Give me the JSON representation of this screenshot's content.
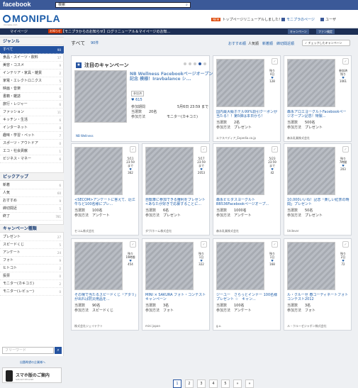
{
  "facebook": {
    "logo": "facebook",
    "search": "検索"
  },
  "header": {
    "logo": "MONIPLA",
    "tagline": "monipla.com",
    "news_badge": "NEW",
    "news": "トップページリニューアルしました！",
    "monipla_page": "モニプラのページ",
    "user": "ユーザ"
  },
  "nav": {
    "mypage": "マイページ",
    "badge": "お知らせ",
    "message": "【モニプラからのお知らせ】ログリニューアル＆マイページのお知...",
    "buttons": [
      "キャンペーン",
      "ファン検定",
      "ファン検定 "
    ]
  },
  "sidebar": {
    "genre_title": "ジャンル",
    "genres": [
      [
        "すべて",
        "90"
      ],
      [
        "食品・スイーツ・飲料",
        "17"
      ],
      [
        "美容・コスメ",
        "9"
      ],
      [
        "インテリア・家具・雑貨",
        "2"
      ],
      [
        "家電・エレクトロニクス",
        "5"
      ],
      [
        "映画・音楽",
        "6"
      ],
      [
        "書籍・雑誌",
        "0"
      ],
      [
        "旅行・レジャー",
        "6"
      ],
      [
        "ファッション",
        "11"
      ],
      [
        "キッチン・生活",
        "6"
      ],
      [
        "インターネット",
        "8"
      ],
      [
        "趣味・学習・ペット",
        "7"
      ],
      [
        "スポーツ・アウトドア",
        "0"
      ],
      [
        "エコ・社会貢献",
        "1"
      ],
      [
        "ビジネス・マネー",
        "6"
      ]
    ],
    "pickup_title": "ピックアップ",
    "pickups": [
      [
        "新着",
        "6"
      ],
      [
        "人気",
        "60"
      ],
      [
        "おすすめ",
        "9"
      ],
      [
        "締切間近",
        "5"
      ],
      [
        "終了",
        "781"
      ]
    ],
    "type_title": "キャンペーン種類",
    "types": [
      [
        "プレゼント",
        "27"
      ],
      [
        "スピードくじ",
        "5"
      ],
      [
        "アンケート",
        "24"
      ],
      [
        "フォト",
        "9"
      ],
      [
        "ヒトコト",
        "2"
      ],
      [
        "投票",
        "0"
      ],
      [
        "モニター(カキコミ)",
        "2"
      ],
      [
        "モニター(レビュー)",
        "0"
      ]
    ],
    "keyword": "フリーワード",
    "help": "出題希望の企業様へ",
    "sp_title": "スマホ版のご案内",
    "sp_sub": "SMARTPHONE"
  },
  "main": {
    "all": "すべて",
    "count": "90件",
    "sorts": [
      "おすすめ順",
      "人気順",
      "新着順",
      "締切間近順"
    ],
    "check": "チェックしたキャンペーン"
  },
  "featured": {
    "title": "注目のキャンペーン",
    "campaign": "NB Wellness Facebookページオープン記念 模様！Iravbalance シ...",
    "tag": "参加済",
    "likes": "615",
    "period_lbl": "参加期間",
    "period": "5月6日 23:59 まで",
    "prize_lbl": "当選数",
    "prize": "20名",
    "method_lbl": "参加方法",
    "method": "モニター(カキコミ)",
    "company": "NB Wellness"
  },
  "cards": [
    {
      "rem": "残り",
      "days": "4日",
      "likes": "128",
      "title": "国内最大級ホテル99%割引クーポンが当たる！！第5弾は本日から！",
      "prize": "2名",
      "method": "プレゼント",
      "company": "エクスペディア_Expedia.co.jp"
    },
    {
      "rem": "参加済",
      "days": "残り",
      "likes": "1061",
      "title": "森永アロエヨーグルトFacebookページオープン記念！特製...",
      "prize": "500名",
      "method": "プレゼント",
      "company": "森永乳業株式会社"
    },
    {
      "rem": "5/11",
      "days": "23:59まで",
      "likes": "362",
      "title": "<SECOM>アンケートに答えて、近江牛など100名様にプレ...",
      "prize": "100名",
      "method": "アンケート",
      "company": "セコム株式会社"
    },
    {
      "rem": "5/17",
      "days": "23:59まで",
      "likes": "2053",
      "title": "自転車に参加できる権利をプレゼント<あなたが好きで応募することに...",
      "prize": "6名",
      "method": "プレゼント",
      "company": "ダヴ/ホーム株式会社"
    },
    {
      "rem": "5/23",
      "days": "23:59まで",
      "likes": "42",
      "title": "森永ビヒダスヨーグルト BB536Facebookページオープ...",
      "prize": "1000名",
      "method": "アンケート",
      "company": "森永乳業株式会社"
    },
    {
      "rem": "残り",
      "days": "7時間",
      "likes": "203",
      "title": "10,000いいね！記念「楽しい紅茶の時間」プレゼント",
      "prize": "50名",
      "method": "プレゼント",
      "company": "Unilever"
    },
    {
      "rem": "残り",
      "days": "19時間",
      "likes": "454",
      "title": "その場で当たるスピードくじ「アタリ」が出れば防災用品を...",
      "prize": "90名",
      "method": "スピードくじ",
      "company": "株式会社ジェイテクト"
    },
    {
      "rem": "残り",
      "days": "1日",
      "likes": "322",
      "title": "MINI × SAKURA フォト・コンテスト キャンペーン",
      "prize": "3名",
      "method": "フォト",
      "company": "mini japan"
    },
    {
      "rem": "残り",
      "days": "1日",
      "likes": "168",
      "title": "ジーユー　さらっとインナー 100名様プレゼント ☆　キャン...",
      "prize": "100名",
      "method": "アンケート",
      "company": "g.u."
    },
    {
      "rem": "残り",
      "days": "2日",
      "likes": "72",
      "title": "ル・クルーゼ 春コーディネートフォトコンテスト2012",
      "prize": "3名",
      "method": "フォト",
      "company": "ル・クルーゼジャポン株式会社"
    }
  ],
  "labels": {
    "prize": "当選数",
    "method": "参加方法"
  },
  "pager": [
    "1",
    "2",
    "3",
    "4",
    "5",
    "»",
    "»"
  ]
}
